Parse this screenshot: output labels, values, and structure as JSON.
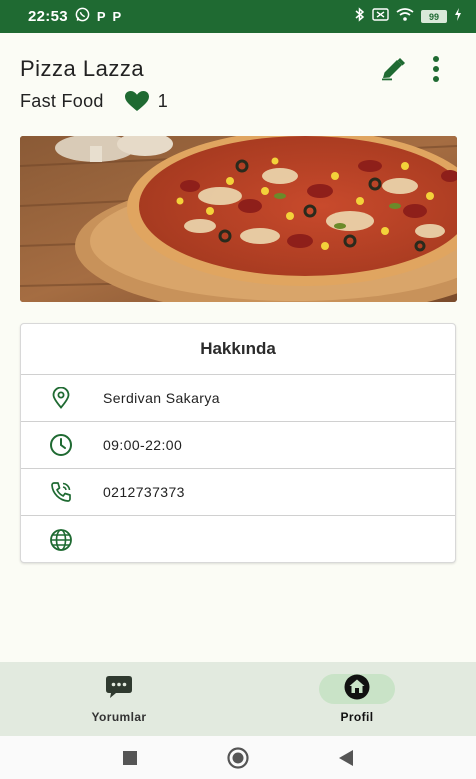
{
  "status_bar": {
    "time": "22:53",
    "notification_glyphs": [
      "P",
      "P"
    ],
    "battery": "99"
  },
  "header": {
    "title": "Pizza Lazza",
    "category": "Fast Food",
    "likes": "1"
  },
  "about": {
    "title": "Hakkında",
    "rows": [
      {
        "icon": "location-pin-icon",
        "text": "Serdivan Sakarya"
      },
      {
        "icon": "clock-icon",
        "text": "09:00-22:00"
      },
      {
        "icon": "phone-icon",
        "text": "0212737373"
      },
      {
        "icon": "globe-icon",
        "text": ""
      }
    ]
  },
  "bottom_nav": {
    "items": [
      {
        "label": "Yorumlar",
        "icon": "chat-bubble-icon",
        "active": false
      },
      {
        "label": "Profil",
        "icon": "home-icon",
        "active": true
      }
    ]
  },
  "colors": {
    "brand_green": "#1f6a32",
    "nav_bg": "#e2eadf",
    "active_pill": "#c9e3c7",
    "page_bg": "#fbfcf5"
  }
}
